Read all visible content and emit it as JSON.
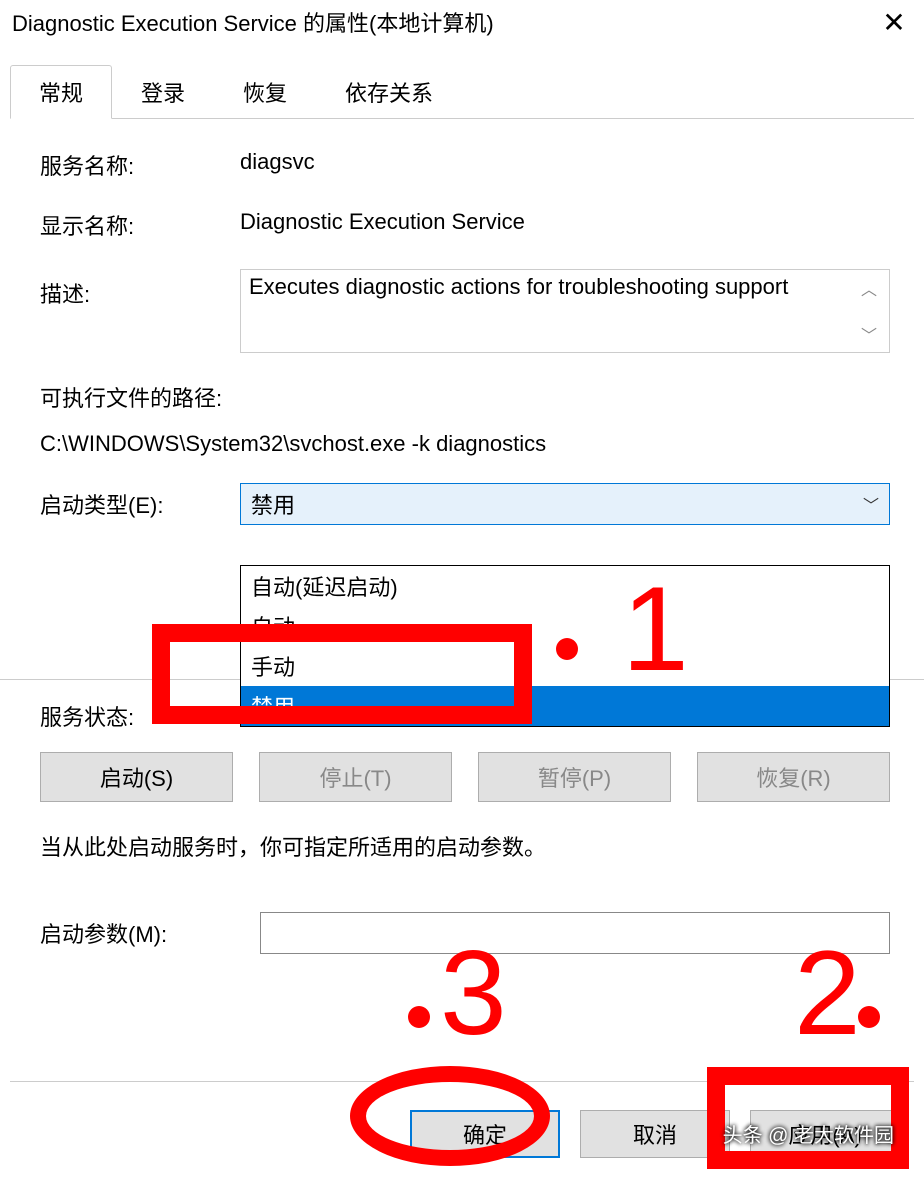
{
  "titlebar": {
    "title": "Diagnostic Execution Service 的属性(本地计算机)"
  },
  "tabs": {
    "general": "常规",
    "logon": "登录",
    "recovery": "恢复",
    "dependencies": "依存关系"
  },
  "labels": {
    "service_name": "服务名称:",
    "display_name": "显示名称:",
    "description": "描述:",
    "exe_path": "可执行文件的路径:",
    "startup_type": "启动类型(E):",
    "service_status": "服务状态:",
    "start_params": "启动参数(M):",
    "hint": "当从此处启动服务时，你可指定所适用的启动参数。"
  },
  "values": {
    "service_name": "diagsvc",
    "display_name": "Diagnostic Execution Service",
    "description": "Executes diagnostic actions for troubleshooting support",
    "exe_path": "C:\\WINDOWS\\System32\\svchost.exe -k diagnostics",
    "startup_selected": "禁用",
    "start_params": ""
  },
  "dropdown": {
    "opt1": "自动(延迟启动)",
    "opt2": "自动",
    "opt3": "手动",
    "opt4": "禁用"
  },
  "buttons": {
    "start": "启动(S)",
    "stop": "停止(T)",
    "pause": "暂停(P)",
    "resume": "恢复(R)",
    "ok": "确定",
    "cancel": "取消",
    "apply": "应用(A)"
  },
  "annotations": {
    "n1": "1",
    "n2": "2",
    "n3": "3"
  },
  "watermark": {
    "text": "头条 @ 老大软件园"
  }
}
